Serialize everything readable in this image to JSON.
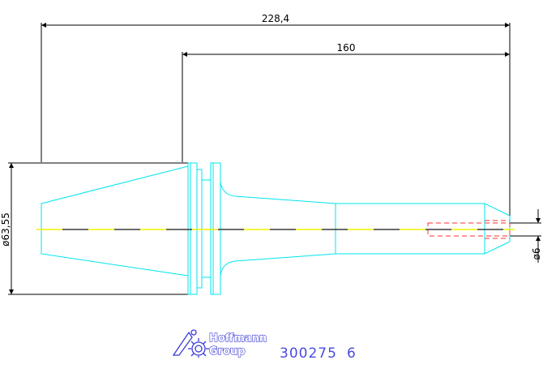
{
  "drawing": {
    "dimensions": {
      "overall_length": "228,4",
      "shank_length": "160",
      "flange_diameter": "ø63,55",
      "bore_diameter": "ø6"
    },
    "logo": {
      "line1": "Hoffmann",
      "line2": "Group"
    },
    "part_number": "300275",
    "part_suffix": "6"
  },
  "colors": {
    "outline": "#00e5ee",
    "dimension": "#000000",
    "centerline_dash": "#f0f000",
    "centerline_dark": "#3c3c3c",
    "hidden_bore": "#ff3030",
    "logo": "#3a3ad8"
  }
}
